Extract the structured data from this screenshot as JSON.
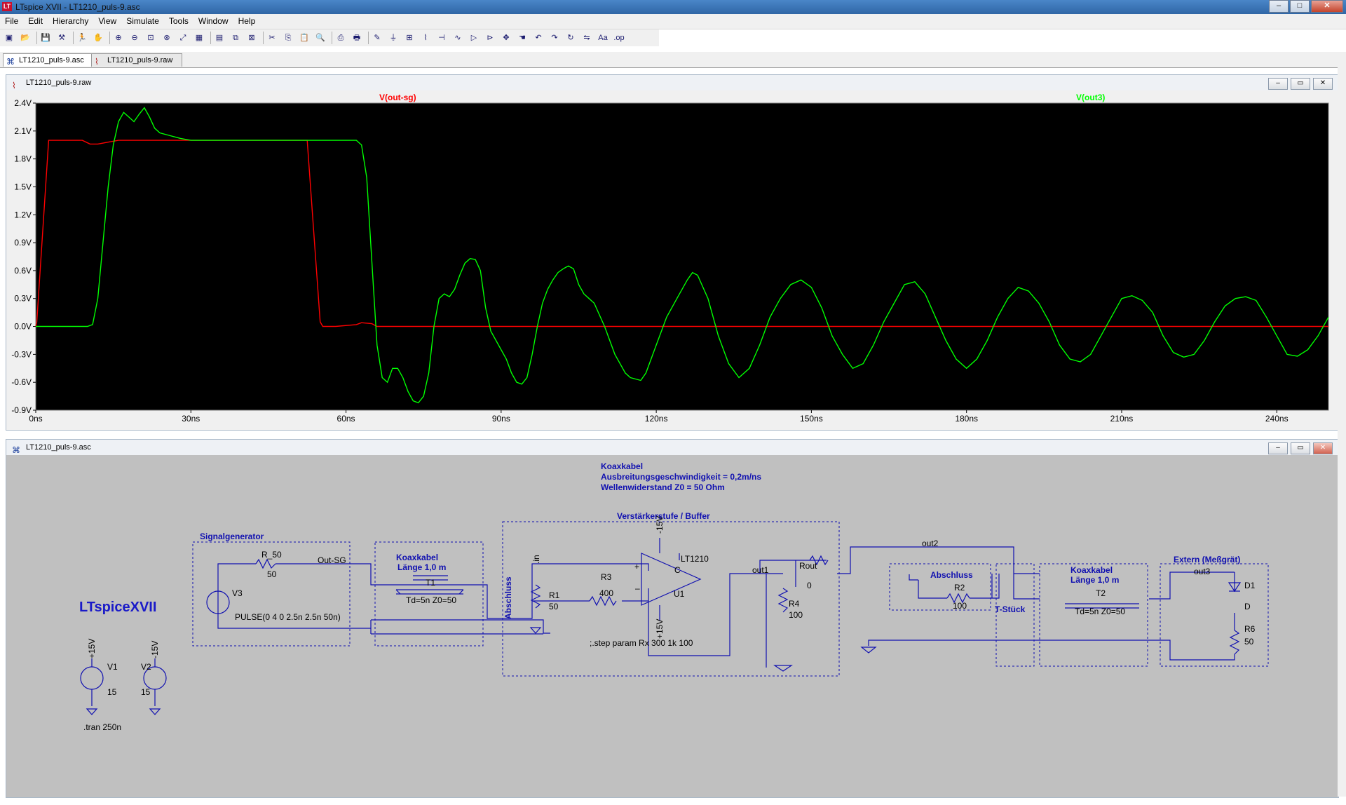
{
  "window": {
    "title": "LTspice XVII - LT1210_puls-9.asc",
    "logo": "LT",
    "controls": {
      "minimize": "–",
      "maximize": "□",
      "close": "✕"
    }
  },
  "menu": [
    "File",
    "Edit",
    "Hierarchy",
    "View",
    "Simulate",
    "Tools",
    "Window",
    "Help"
  ],
  "toolbar_icons": [
    "new-schematic-icon",
    "open-icon",
    "save-icon",
    "control-panel-icon",
    "run-icon",
    "halt-icon",
    "zoom-in-icon",
    "zoom-out-icon",
    "zoom-fit-icon",
    "zoom-cancel-icon",
    "autorange-icon",
    "grid-icon",
    "tile-icon",
    "cascade-icon",
    "close-window-icon",
    "cut-icon",
    "copy-icon",
    "paste-icon",
    "find-icon",
    "print-setup-icon",
    "print-icon",
    "wire-icon",
    "ground-icon",
    "label-icon",
    "resistor-icon",
    "capacitor-icon",
    "inductor-icon",
    "diode-icon",
    "component-icon",
    "move-icon",
    "drag-icon",
    "undo-icon",
    "redo-icon",
    "rotate-icon",
    "mirror-icon",
    "text-icon",
    "spice-directive-icon"
  ],
  "tabs": [
    {
      "label": "LT1210_puls-9.asc",
      "icon": "schematic-icon"
    },
    {
      "label": "LT1210_puls-9.raw",
      "icon": "waveform-icon"
    }
  ],
  "waveform_window": {
    "title": "LT1210_puls-9.raw",
    "legend": [
      {
        "label": "V(out-sg)",
        "color": "#ff0000"
      },
      {
        "label": "V(out3)",
        "color": "#00ff00"
      }
    ]
  },
  "chart_data": {
    "type": "line",
    "title": "",
    "xlabel": "",
    "ylabel": "",
    "xlim": [
      0,
      250
    ],
    "ylim": [
      -0.9,
      2.4
    ],
    "xticks": [
      "0ns",
      "30ns",
      "60ns",
      "90ns",
      "120ns",
      "150ns",
      "180ns",
      "210ns",
      "240ns"
    ],
    "yticks": [
      "2.4V",
      "2.1V",
      "1.8V",
      "1.5V",
      "1.2V",
      "0.9V",
      "0.6V",
      "0.3V",
      "0.0V",
      "-0.3V",
      "-0.6V",
      "-0.9V"
    ],
    "grid": false,
    "background": "#000000",
    "series": [
      {
        "name": "V(out-sg)",
        "color": "#ff0000",
        "x": [
          0,
          0.2,
          2.5,
          9,
          10.5,
          12,
          14,
          16,
          20,
          30,
          40,
          50,
          52.5,
          55,
          55.5,
          56,
          58,
          62,
          63,
          65,
          66,
          70,
          100,
          150,
          200,
          250
        ],
        "y": [
          0.0,
          0.05,
          2.0,
          2.0,
          1.96,
          1.96,
          1.98,
          2.0,
          2.0,
          2.0,
          2.0,
          2.0,
          2.0,
          0.05,
          0.0,
          0.0,
          0.0,
          0.02,
          0.04,
          0.03,
          0.0,
          0.0,
          0.0,
          0.0,
          0.0,
          0.0
        ]
      },
      {
        "name": "V(out3)",
        "color": "#00ff00",
        "x": [
          0,
          10,
          11,
          12,
          13,
          14,
          15,
          16,
          17,
          18,
          19,
          20,
          21,
          22,
          23,
          24,
          26,
          28,
          30,
          35,
          40,
          45,
          50,
          55,
          60,
          62,
          63,
          64,
          65,
          66,
          67,
          68,
          69,
          70,
          71,
          72,
          73,
          74,
          75,
          76,
          77,
          78,
          79,
          80,
          81,
          82,
          83,
          84,
          85,
          86,
          87,
          88,
          89,
          90,
          91,
          92,
          93,
          94,
          95,
          96,
          97,
          98,
          99,
          100,
          101,
          102,
          103,
          104,
          105,
          106,
          107,
          108,
          110,
          112,
          114,
          115,
          117,
          118,
          120,
          122,
          124,
          126,
          127,
          128,
          130,
          132,
          134,
          136,
          138,
          140,
          142,
          144,
          146,
          148,
          150,
          152,
          154,
          156,
          158,
          160,
          162,
          164,
          166,
          168,
          170,
          172,
          174,
          176,
          178,
          180,
          182,
          184,
          186,
          188,
          190,
          192,
          194,
          196,
          198,
          200,
          202,
          204,
          206,
          208,
          210,
          212,
          214,
          216,
          218,
          220,
          222,
          224,
          226,
          228,
          230,
          232,
          234,
          236,
          238,
          240,
          242,
          244,
          246,
          248,
          250
        ],
        "y": [
          0.0,
          0.0,
          0.02,
          0.3,
          0.9,
          1.5,
          1.95,
          2.2,
          2.3,
          2.25,
          2.2,
          2.28,
          2.35,
          2.25,
          2.13,
          2.08,
          2.05,
          2.02,
          2.0,
          2.0,
          2.0,
          2.0,
          2.0,
          2.0,
          2.0,
          2.0,
          1.95,
          1.6,
          0.7,
          -0.2,
          -0.55,
          -0.6,
          -0.45,
          -0.45,
          -0.55,
          -0.7,
          -0.8,
          -0.82,
          -0.75,
          -0.5,
          0.0,
          0.3,
          0.35,
          0.32,
          0.4,
          0.55,
          0.68,
          0.73,
          0.72,
          0.6,
          0.2,
          -0.05,
          -0.15,
          -0.25,
          -0.35,
          -0.5,
          -0.6,
          -0.62,
          -0.55,
          -0.3,
          0.0,
          0.25,
          0.4,
          0.5,
          0.58,
          0.62,
          0.65,
          0.62,
          0.45,
          0.35,
          0.3,
          0.25,
          0.0,
          -0.3,
          -0.5,
          -0.55,
          -0.58,
          -0.5,
          -0.2,
          0.1,
          0.3,
          0.5,
          0.58,
          0.55,
          0.3,
          -0.1,
          -0.4,
          -0.55,
          -0.45,
          -0.2,
          0.1,
          0.3,
          0.45,
          0.5,
          0.42,
          0.2,
          -0.1,
          -0.3,
          -0.45,
          -0.4,
          -0.2,
          0.05,
          0.25,
          0.45,
          0.48,
          0.35,
          0.1,
          -0.15,
          -0.35,
          -0.45,
          -0.35,
          -0.15,
          0.1,
          0.3,
          0.42,
          0.38,
          0.25,
          0.05,
          -0.2,
          -0.35,
          -0.38,
          -0.3,
          -0.1,
          0.1,
          0.3,
          0.33,
          0.28,
          0.15,
          -0.1,
          -0.28,
          -0.33,
          -0.3,
          -0.15,
          0.05,
          0.22,
          0.3,
          0.32,
          0.28,
          0.1,
          -0.1,
          -0.3,
          -0.32,
          -0.25,
          -0.1,
          0.1
        ]
      }
    ]
  },
  "schematic_window": {
    "title": "LT1210_puls-9.asc",
    "app_label": "LTspiceXVII",
    "header_note": [
      "Koaxkabel",
      "Ausbreitungsgeschwindigkeit = 0,2m/ns",
      "Wellenwiderstand Z0 = 50 Ohm"
    ],
    "blocks": {
      "signalgenerator": "Signalgenerator",
      "coax1_title": [
        "Koaxkabel",
        "Länge 1,0 m"
      ],
      "buffer": "Verstärkerstufe / Buffer",
      "abschluss_vert": "Abschluss",
      "abschluss2": "Abschluss",
      "tstueck": "T-Stück",
      "coax2_title": [
        "Koaxkabel",
        "Länge 1,0 m"
      ],
      "extern": "Extern (Meßgrät)"
    },
    "components": {
      "r50": {
        "name": "R_50",
        "value": "50"
      },
      "v3": {
        "name": "V3",
        "value": "PULSE(0 4 0 2.5n 2.5n 50n)"
      },
      "t1": {
        "name": "T1",
        "value": "Td=5n Z0=50"
      },
      "r1": {
        "name": "R1",
        "value": "50"
      },
      "r3": {
        "name": "R3",
        "value": "400"
      },
      "u1": {
        "name": "U1",
        "part": "LT1210",
        "plus": "+",
        "minus": "–",
        "c": "C"
      },
      "rout": {
        "name": "Rout",
        "value": "0"
      },
      "r4": {
        "name": "R4",
        "value": "100"
      },
      "r2": {
        "name": "R2",
        "value": "100"
      },
      "t2": {
        "name": "T2",
        "value": "Td=5n Z0=50"
      },
      "d1": {
        "name": "D1",
        "value": "D"
      },
      "r6": {
        "name": "R6",
        "value": "50"
      },
      "v1": {
        "name": "V1",
        "value": "15"
      },
      "v2": {
        "name": "V2",
        "value": "15"
      }
    },
    "net_labels": {
      "out_sg": "Out-SG",
      "in": ".in",
      "out1": "out1",
      "out2": "out2",
      "out3": "out3",
      "plus15_u1": "+15V",
      "minus15_u1": "-15V",
      "plus15_v1": "+15V",
      "minus15_v2": "-15V"
    },
    "directives": {
      "step": ";.step param Rx 300 1k 100",
      "tran": ".tran 250n"
    }
  }
}
